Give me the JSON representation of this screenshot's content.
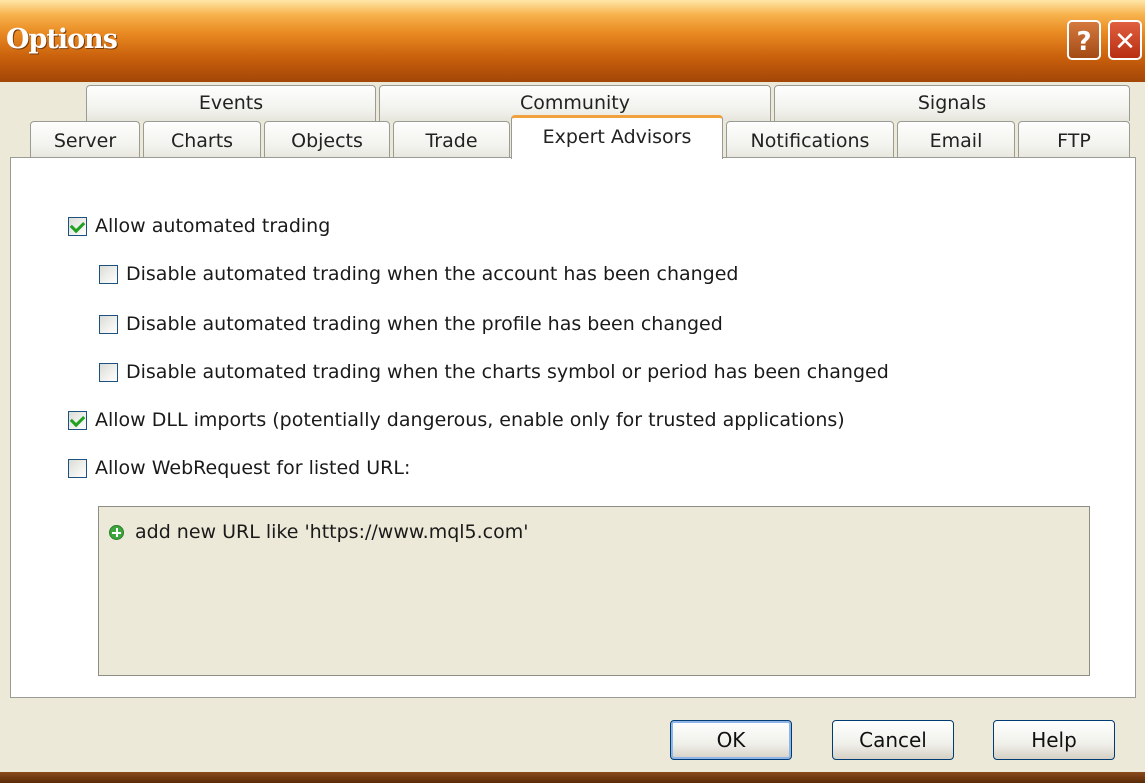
{
  "window": {
    "title": "Options",
    "help_label": "?",
    "close_label": "✕"
  },
  "tabs": {
    "back_row": [
      "Events",
      "Community",
      "Signals"
    ],
    "front_row": [
      "Server",
      "Charts",
      "Objects",
      "Trade",
      "Expert Advisors",
      "Notifications",
      "Email",
      "FTP"
    ],
    "active": "Expert Advisors"
  },
  "options": {
    "allow_automated_trading": {
      "label": "Allow automated trading",
      "checked": true
    },
    "disable_on_account_change": {
      "label": "Disable automated trading when the account has been changed",
      "checked": false
    },
    "disable_on_profile_change": {
      "label": "Disable automated trading when the profile has been changed",
      "checked": false
    },
    "disable_on_chart_change": {
      "label": "Disable automated trading when the charts symbol or period has been changed",
      "checked": false
    },
    "allow_dll_imports": {
      "label": "Allow DLL imports (potentially dangerous, enable only for trusted applications)",
      "checked": true
    },
    "allow_webrequest": {
      "label": "Allow WebRequest for listed URL:",
      "checked": false
    }
  },
  "url_list": {
    "add_label": "add new URL like 'https://www.mql5.com'"
  },
  "buttons": {
    "ok": "OK",
    "cancel": "Cancel",
    "help": "Help"
  }
}
